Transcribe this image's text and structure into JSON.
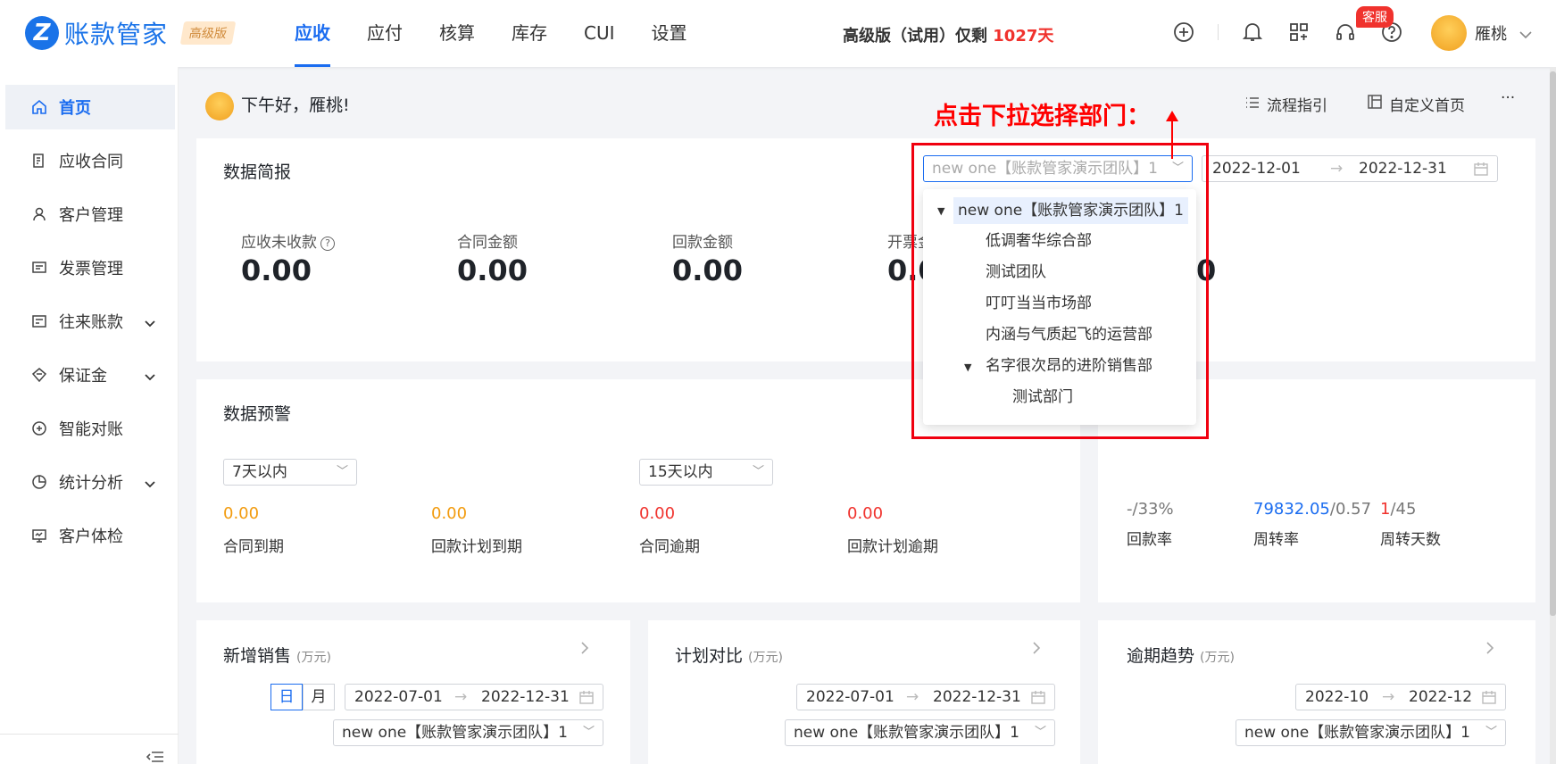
{
  "header": {
    "logo_text": "账款管家",
    "edition_badge": "高级版",
    "nav": [
      "应收",
      "应付",
      "核算",
      "库存",
      "CUI",
      "设置"
    ],
    "active_nav": "应收",
    "trial_prefix": "高级版（试用）仅剩 ",
    "trial_days": "1027天",
    "kefu_badge": "客服",
    "username": "雁桃"
  },
  "sidebar": {
    "items": [
      {
        "label": "首页",
        "icon": "home-icon",
        "active": true
      },
      {
        "label": "应收合同",
        "icon": "contract-icon"
      },
      {
        "label": "客户管理",
        "icon": "user-icon"
      },
      {
        "label": "发票管理",
        "icon": "invoice-icon"
      },
      {
        "label": "往来账款",
        "icon": "ledger-icon",
        "expandable": true
      },
      {
        "label": "保证金",
        "icon": "diamond-icon",
        "expandable": true
      },
      {
        "label": "智能对账",
        "icon": "reconcile-icon"
      },
      {
        "label": "统计分析",
        "icon": "pie-chart-icon",
        "expandable": true
      },
      {
        "label": "客户体检",
        "icon": "monitor-icon"
      }
    ]
  },
  "main": {
    "greeting": "下午好，雁桃!",
    "actions": {
      "guide": "流程指引",
      "customize": "自定义首页",
      "more": "···"
    },
    "summary": {
      "title": "数据简报",
      "dept_select": "new one【账款管家演示团队】1",
      "date_start": "2022-12-01",
      "date_end": "2022-12-31",
      "stats": [
        {
          "label": "应收未收款",
          "value": "0.00"
        },
        {
          "label": "合同金额",
          "value": "0.00"
        },
        {
          "label": "回款金额",
          "value": "0.00"
        },
        {
          "label": "开票金",
          "value": "0.0"
        },
        {
          "label": "",
          "value": "0"
        }
      ]
    },
    "warning": {
      "title": "数据预警",
      "select_a": "7天以内",
      "select_b": "15天以内",
      "items": [
        {
          "value": "0.00",
          "label": "合同到期"
        },
        {
          "value": "0.00",
          "label": "回款计划到期"
        },
        {
          "value": "0.00",
          "label": "合同逾期"
        },
        {
          "value": "0.00",
          "label": "回款计划逾期"
        }
      ]
    },
    "turnover": {
      "rate_prefix": "-/",
      "rate_value": "33%",
      "rate_label": "回款率",
      "turn_value": "79832.05",
      "turn_suffix": "/0.57",
      "turn_label": "周转率",
      "days_value": "1",
      "days_suffix": "/45",
      "days_label": "周转天数"
    },
    "cards": [
      {
        "title": "新增销售",
        "unit": "(万元)",
        "toggle": [
          "日",
          "月"
        ],
        "date_start": "2022-07-01",
        "date_end": "2022-12-31",
        "dept": "new one【账款管家演示团队】1"
      },
      {
        "title": "计划对比",
        "unit": "(万元)",
        "date_start": "2022-07-01",
        "date_end": "2022-12-31",
        "dept": "new one【账款管家演示团队】1"
      },
      {
        "title": "逾期趋势",
        "unit": "(万元)",
        "date_start": "2022-10",
        "date_end": "2022-12",
        "dept": "new one【账款管家演示团队】1"
      }
    ]
  },
  "dropdown": {
    "root": "new one【账款管家演示团队】1",
    "children": [
      "低调奢华综合部",
      "测试团队",
      "叮叮当当市场部",
      "内涵与气质起飞的运营部",
      "名字很次昂的进阶销售部"
    ],
    "grandchild": "测试部门"
  },
  "annotation": "点击下拉选择部门："
}
